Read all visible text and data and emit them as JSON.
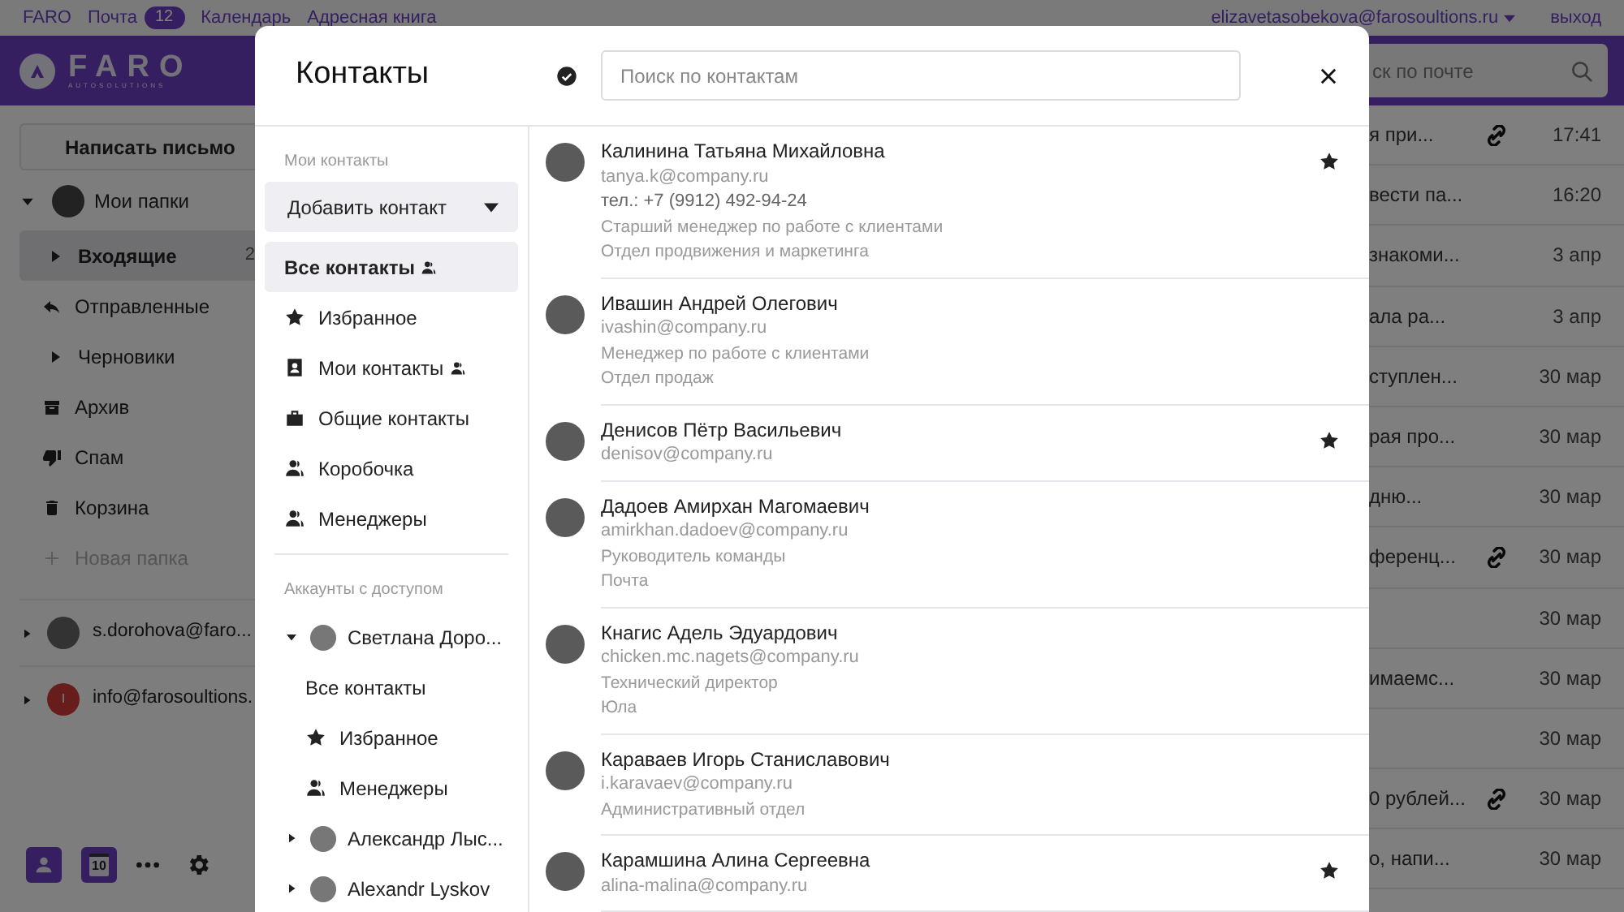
{
  "top_bar": {
    "links": [
      {
        "label": "FARO"
      },
      {
        "label": "Почта",
        "badge": "12"
      },
      {
        "label": "Календарь"
      },
      {
        "label": "Адресная книга"
      }
    ],
    "user": "elizavetasobekova@farosoultions.ru",
    "logout": "выход"
  },
  "header": {
    "logo": {
      "name": "FARO",
      "tagline": "AUTOSOLUTIONS"
    },
    "search_placeholder": "ск по почте"
  },
  "sidebar": {
    "compose": "Написать письмо",
    "my_folders": {
      "label": "Мои папки",
      "expanded": true
    },
    "folders": [
      {
        "label": "Входящие",
        "kind": "inbox",
        "count": "2",
        "selected": true
      },
      {
        "label": "Отправленные",
        "kind": "sent",
        "selected": false
      },
      {
        "label": "Черновики",
        "kind": "drafts",
        "selected": false
      },
      {
        "label": "Архив",
        "kind": "archive",
        "selected": false
      },
      {
        "label": "Спам",
        "kind": "spam",
        "selected": false
      },
      {
        "label": "Корзина",
        "kind": "trash",
        "selected": false
      },
      {
        "label": "Новая папка",
        "kind": "new",
        "selected": false
      }
    ],
    "accounts": [
      {
        "label": "s.dorohova@faro...",
        "expanded": false
      },
      {
        "label": "info@farosoultions.",
        "expanded": false,
        "letter": "I"
      }
    ],
    "calendar_day": "10"
  },
  "mail_rows": [
    {
      "snippet": "я при...",
      "attachment": true,
      "date": "17:41"
    },
    {
      "snippet": "вести па...",
      "attachment": false,
      "date": "16:20"
    },
    {
      "snippet": "знакоми...",
      "attachment": false,
      "date": "3 апр"
    },
    {
      "snippet": "ала ра...",
      "attachment": false,
      "date": "3 апр"
    },
    {
      "snippet": "ступлен...",
      "attachment": false,
      "date": "30 мар"
    },
    {
      "snippet": "рая про...",
      "attachment": false,
      "date": "30 мар"
    },
    {
      "snippet": "дню...",
      "attachment": false,
      "date": "30 мар"
    },
    {
      "snippet": "ференц...",
      "attachment": true,
      "date": "30 мар"
    },
    {
      "attachment": false,
      "date": "30 мар"
    },
    {
      "snippet": "имаемс...",
      "attachment": false,
      "date": "30 мар"
    },
    {
      "attachment": false,
      "date": "30 мар"
    },
    {
      "snippet": "0 рублей...",
      "attachment": true,
      "date": "30 мар"
    },
    {
      "snippet": "о, напи...",
      "attachment": false,
      "date": "30 мар"
    }
  ],
  "contacts_dialog": {
    "title": "Контакты",
    "search_placeholder": "Поиск по контактам",
    "my_contacts_label": "Мои контакты",
    "add_button": "Добавить контакт",
    "nav": [
      {
        "label": "Все контакты",
        "kind": "all",
        "shared": true,
        "selected": true
      },
      {
        "label": "Избранное",
        "kind": "favorites",
        "shared": false,
        "selected": false
      },
      {
        "label": "Мои контакты",
        "kind": "personal",
        "shared": true,
        "selected": false
      },
      {
        "label": "Общие контакты",
        "kind": "common",
        "shared": false,
        "selected": false
      },
      {
        "label": "Коробочка",
        "kind": "group",
        "shared": false,
        "selected": false
      },
      {
        "label": "Менеджеры",
        "kind": "group",
        "shared": false,
        "selected": false
      }
    ],
    "accounts_label": "Аккаунты с доступом",
    "accounts": [
      {
        "name": "Светлана Доро...",
        "expanded": true,
        "children": [
          {
            "label": "Все контакты",
            "kind": "all"
          },
          {
            "label": "Избранное",
            "kind": "favorites"
          },
          {
            "label": "Менеджеры",
            "kind": "group"
          }
        ]
      },
      {
        "name": "Александр Лыс...",
        "expanded": false
      },
      {
        "name": "Alexandr Lyskov",
        "expanded": false
      }
    ],
    "contacts": [
      {
        "name": "Калинина Татьяна Михайловна",
        "email": "tanya.k@company.ru",
        "details": [
          {
            "kind": "phone",
            "text": "тел.: +7 (9912) 492-94-24"
          },
          {
            "kind": "text",
            "text": "Старший менеджер по работе с клиентами"
          },
          {
            "kind": "text",
            "text": "Отдел продвижения и маркетинга"
          }
        ],
        "starred": true
      },
      {
        "name": "Ивашин Андрей Олегович",
        "email": "ivashin@company.ru",
        "details": [
          {
            "kind": "text",
            "text": "Менеджер по работе с клиентами"
          },
          {
            "kind": "text",
            "text": "Отдел продаж"
          }
        ],
        "starred": false
      },
      {
        "name": "Денисов Пётр Васильевич",
        "email": "denisov@company.ru",
        "starred": true
      },
      {
        "name": "Дадоев Амирхан Магомаевич",
        "email": "amirkhan.dadoev@company.ru",
        "details": [
          {
            "kind": "text",
            "text": "Руководитель команды"
          },
          {
            "kind": "text",
            "text": "Почта"
          }
        ],
        "starred": false
      },
      {
        "name": "Кнагис Адель Эдуардович",
        "email": "chicken.mc.nagets@company.ru",
        "details": [
          {
            "kind": "text",
            "text": "Технический директор"
          },
          {
            "kind": "text",
            "text": "Юла"
          }
        ],
        "starred": false
      },
      {
        "name": "Караваев Игорь Станиславович",
        "email": "i.karavaev@company.ru",
        "details": [
          {
            "kind": "text",
            "text": "Административный отдел"
          }
        ],
        "starred": false
      },
      {
        "name": "Карамшина Алина Сергеевна",
        "email": "alina-malina@company.ru",
        "starred": true
      }
    ]
  }
}
